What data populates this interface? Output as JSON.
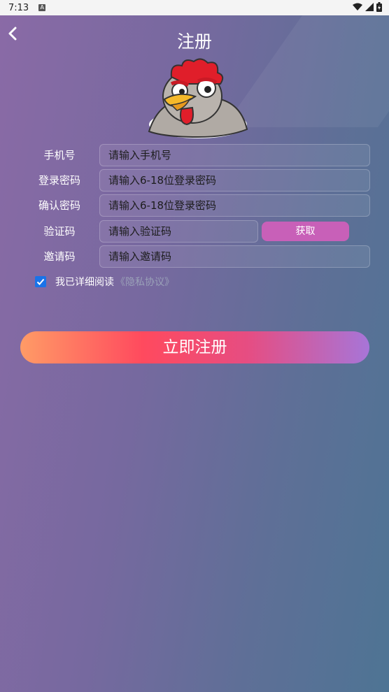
{
  "status_bar": {
    "time": "7:13",
    "notif_badge": "A"
  },
  "header": {
    "title": "注册"
  },
  "form": {
    "phone": {
      "label": "手机号",
      "placeholder": "请输入手机号"
    },
    "password": {
      "label": "登录密码",
      "placeholder": "请输入6-18位登录密码"
    },
    "confirm_password": {
      "label": "确认密码",
      "placeholder": "请输入6-18位登录密码"
    },
    "code": {
      "label": "验证码",
      "placeholder": "请输入验证码",
      "button": "获取"
    },
    "invite": {
      "label": "邀请码",
      "placeholder": "请输入邀请码"
    }
  },
  "agreement": {
    "checked": true,
    "text": "我已详细阅读",
    "link": "《隐私协议》"
  },
  "submit": {
    "label": "立即注册"
  },
  "colors": {
    "accent_button": "#c860b8",
    "checkbox": "#1a73e8"
  }
}
